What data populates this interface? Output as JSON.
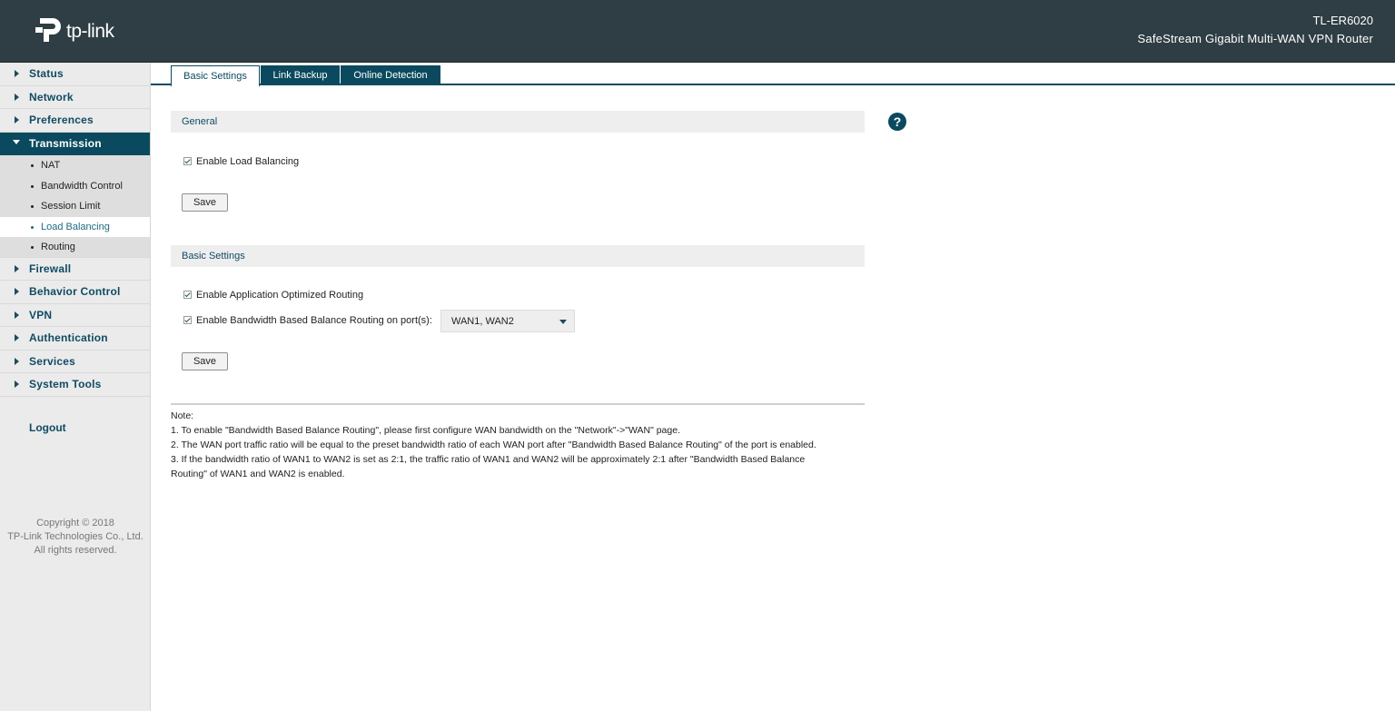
{
  "header": {
    "logo_text": "tp-link",
    "model": "TL-ER6020",
    "product": "SafeStream Gigabit Multi-WAN VPN Router",
    "colors": {
      "header_bg": "#2f3d44",
      "accent": "#0b4a5e"
    }
  },
  "sidebar": {
    "items_top": [
      {
        "label": "Status"
      },
      {
        "label": "Network"
      },
      {
        "label": "Preferences"
      },
      {
        "label": "Transmission"
      }
    ],
    "sub_items": [
      {
        "label": "NAT"
      },
      {
        "label": "Bandwidth Control"
      },
      {
        "label": "Session Limit"
      },
      {
        "label": "Load Balancing"
      },
      {
        "label": "Routing"
      }
    ],
    "items_bottom": [
      {
        "label": "Firewall"
      },
      {
        "label": "Behavior Control"
      },
      {
        "label": "VPN"
      },
      {
        "label": "Authentication"
      },
      {
        "label": "Services"
      },
      {
        "label": "System Tools"
      }
    ],
    "logout": "Logout",
    "copyright": [
      "Copyright © 2018",
      "TP-Link Technologies Co., Ltd.",
      "All rights reserved."
    ]
  },
  "tabs": [
    {
      "label": "Basic Settings",
      "active": true
    },
    {
      "label": "Link Backup",
      "active": false
    },
    {
      "label": "Online Detection",
      "active": false
    }
  ],
  "general": {
    "title": "General",
    "enable_load_balancing": {
      "label": "Enable Load Balancing",
      "checked": true
    },
    "save": "Save"
  },
  "basic": {
    "title": "Basic Settings",
    "app_routing": {
      "label": "Enable Application Optimized Routing",
      "checked": true
    },
    "bw_routing": {
      "label": "Enable Bandwidth Based Balance Routing on port(s):",
      "checked": true
    },
    "ports_select": "WAN1, WAN2",
    "save": "Save"
  },
  "help_icon": "?",
  "notes": {
    "title": "Note:",
    "lines": [
      "1. To enable \"Bandwidth Based Balance Routing\", please first configure WAN bandwidth on the \"Network\"->\"WAN\" page.",
      "2. The WAN port traffic ratio will be equal to the preset bandwidth ratio of each WAN port after \"Bandwidth Based Balance Routing\" of the port is enabled.",
      "3. If the bandwidth ratio of WAN1 to WAN2 is set as 2:1, the traffic ratio of WAN1 and WAN2 will be approximately 2:1 after \"Bandwidth Based Balance",
      "Routing\" of WAN1 and WAN2 is enabled."
    ]
  }
}
